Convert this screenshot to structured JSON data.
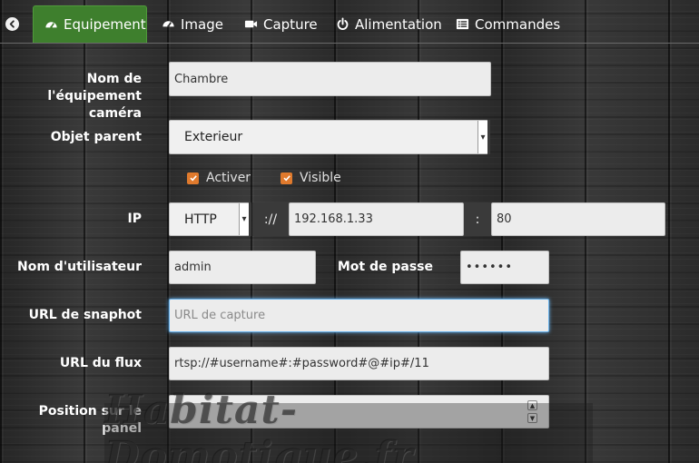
{
  "tabs": [
    {
      "label": "Equipement",
      "icon": "tachometer-icon",
      "active": true
    },
    {
      "label": "Image",
      "icon": "tachometer-icon"
    },
    {
      "label": "Capture",
      "icon": "video-camera-icon"
    },
    {
      "label": "Alimentation",
      "icon": "power-icon"
    },
    {
      "label": "Commandes",
      "icon": "list-icon"
    }
  ],
  "form": {
    "name_label_line1": "Nom de l'équipement",
    "name_label_line2": "caméra",
    "name_value": "Chambre",
    "parent_label": "Objet parent",
    "parent_value": "Exterieur",
    "activate_label": "Activer",
    "activate_checked": true,
    "visible_label": "Visible",
    "visible_checked": true,
    "ip_label": "IP",
    "protocol_value": "HTTP",
    "scheme_sep": "://",
    "ip_value": "192.168.1.33",
    "port_sep": ":",
    "port_value": "80",
    "username_label": "Nom d'utilisateur",
    "username_value": "admin",
    "password_label": "Mot de passe",
    "password_value": "••••••",
    "snapshot_label": "URL de snaphot",
    "snapshot_placeholder": "URL de capture",
    "stream_label": "URL du flux",
    "stream_value": "rtsp://#username#:#password#@#ip#/11",
    "panel_label": "Position sur le panel"
  },
  "watermark": "Habitat-Domotique.fr",
  "colors": {
    "active_tab": "#3e7f2d",
    "checkbox": "#e07a2d",
    "focus": "#66afe9"
  }
}
